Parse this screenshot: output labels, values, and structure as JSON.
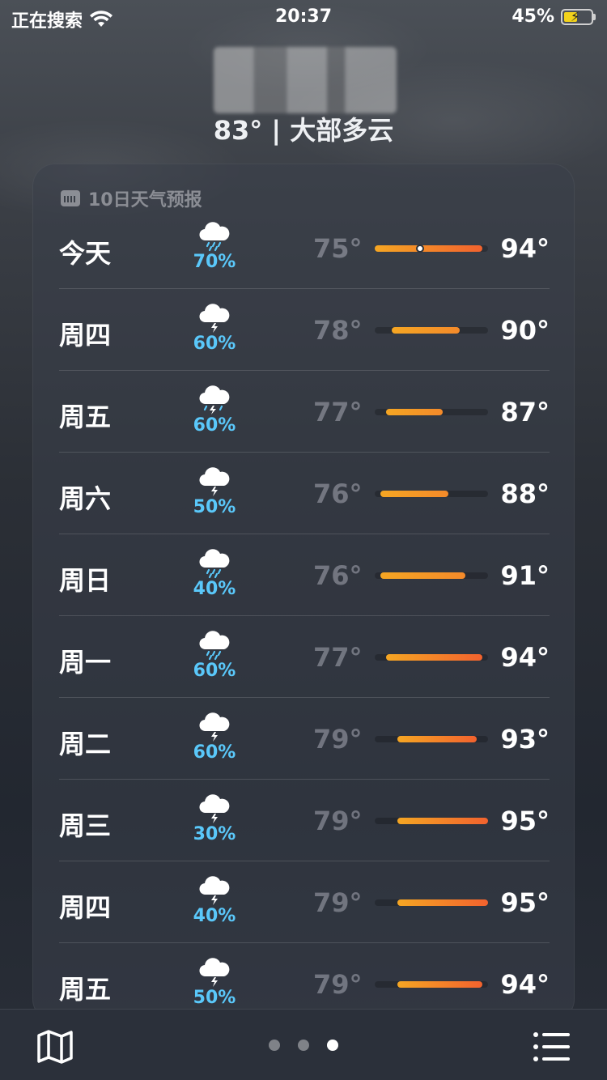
{
  "status_bar": {
    "carrier": "正在搜索",
    "time": "20:37",
    "battery": "45%"
  },
  "header": {
    "temp_line": "83° | 大部多云"
  },
  "forecast": {
    "title": "10日天气预报",
    "scale_min": 75,
    "scale_max": 95,
    "current_temp": 83,
    "days": [
      {
        "day": "今天",
        "icon": "rain-cloud-icon",
        "precip": "70%",
        "low": "75°",
        "high": "94°",
        "low_v": 75,
        "high_v": 94,
        "current": true
      },
      {
        "day": "周四",
        "icon": "thunderstorm-cloud-icon",
        "precip": "60%",
        "low": "78°",
        "high": "90°",
        "low_v": 78,
        "high_v": 90
      },
      {
        "day": "周五",
        "icon": "thunderstorm-rain-cloud-icon",
        "precip": "60%",
        "low": "77°",
        "high": "87°",
        "low_v": 77,
        "high_v": 87
      },
      {
        "day": "周六",
        "icon": "thunderstorm-cloud-icon",
        "precip": "50%",
        "low": "76°",
        "high": "88°",
        "low_v": 76,
        "high_v": 88
      },
      {
        "day": "周日",
        "icon": "rain-cloud-icon",
        "precip": "40%",
        "low": "76°",
        "high": "91°",
        "low_v": 76,
        "high_v": 91
      },
      {
        "day": "周一",
        "icon": "rain-cloud-icon",
        "precip": "60%",
        "low": "77°",
        "high": "94°",
        "low_v": 77,
        "high_v": 94
      },
      {
        "day": "周二",
        "icon": "thunderstorm-cloud-icon",
        "precip": "60%",
        "low": "79°",
        "high": "93°",
        "low_v": 79,
        "high_v": 93
      },
      {
        "day": "周三",
        "icon": "thunderstorm-cloud-icon",
        "precip": "30%",
        "low": "79°",
        "high": "95°",
        "low_v": 79,
        "high_v": 95
      },
      {
        "day": "周四",
        "icon": "thunderstorm-cloud-icon",
        "precip": "40%",
        "low": "79°",
        "high": "95°",
        "low_v": 79,
        "high_v": 95
      },
      {
        "day": "周五",
        "icon": "thunderstorm-cloud-icon",
        "precip": "50%",
        "low": "79°",
        "high": "94°",
        "low_v": 79,
        "high_v": 94
      }
    ]
  },
  "bottom_bar": {
    "page_count": 3,
    "active_page": 3
  },
  "colors": {
    "precip": "#5ac8fa",
    "bar_cool": "#f5a623",
    "bar_warm": "#f2622e"
  }
}
